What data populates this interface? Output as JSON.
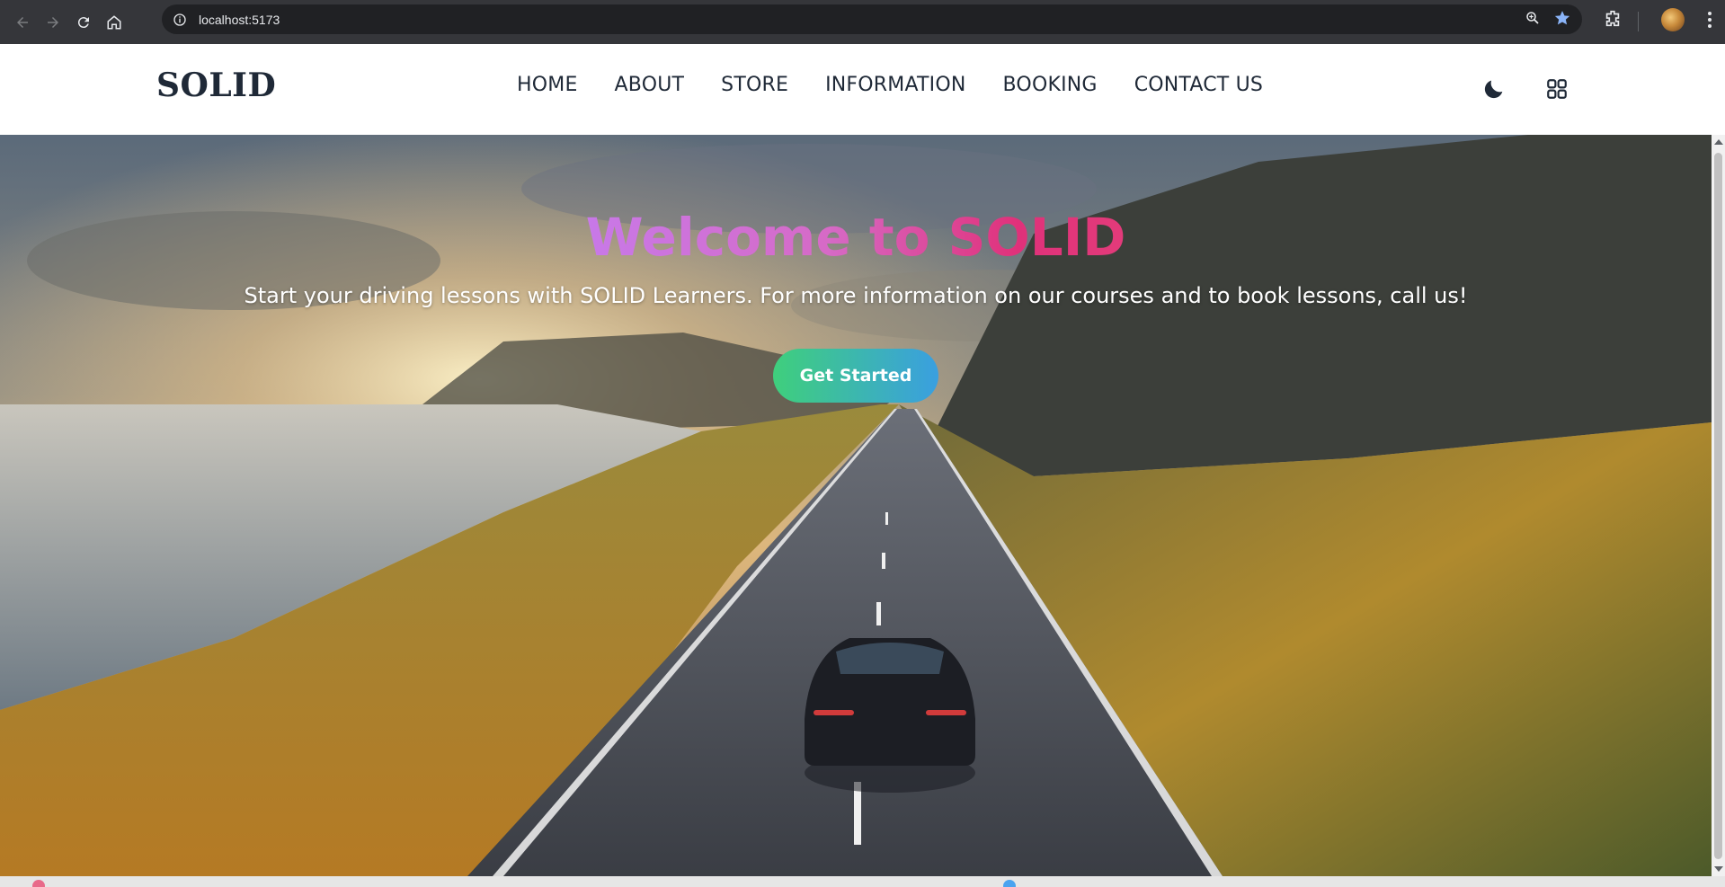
{
  "browser": {
    "url": "localhost:5173",
    "icons": [
      "back-icon",
      "forward-icon",
      "reload-icon",
      "home-icon",
      "site-info-icon",
      "zoom-icon",
      "bookmark-star-icon",
      "extensions-icon",
      "profile-avatar",
      "menu-icon"
    ]
  },
  "header": {
    "logo": "SOLID",
    "nav": [
      "HOME",
      "ABOUT",
      "STORE",
      "INFORMATION",
      "BOOKING",
      "CONTACT US"
    ],
    "icons": [
      "moon-icon",
      "grid-icon"
    ]
  },
  "hero": {
    "title": "Welcome to SOLID",
    "subtitle": "Start your driving lessons with SOLID Learners. For more information on our courses and to book lessons, call us!",
    "cta_label": "Get Started"
  },
  "colors": {
    "title_gradient": [
      "#c879e8",
      "#e0317a"
    ],
    "cta_gradient": [
      "#3fcf7c",
      "#3a9fe0"
    ],
    "nav_text": "#1f2937"
  }
}
